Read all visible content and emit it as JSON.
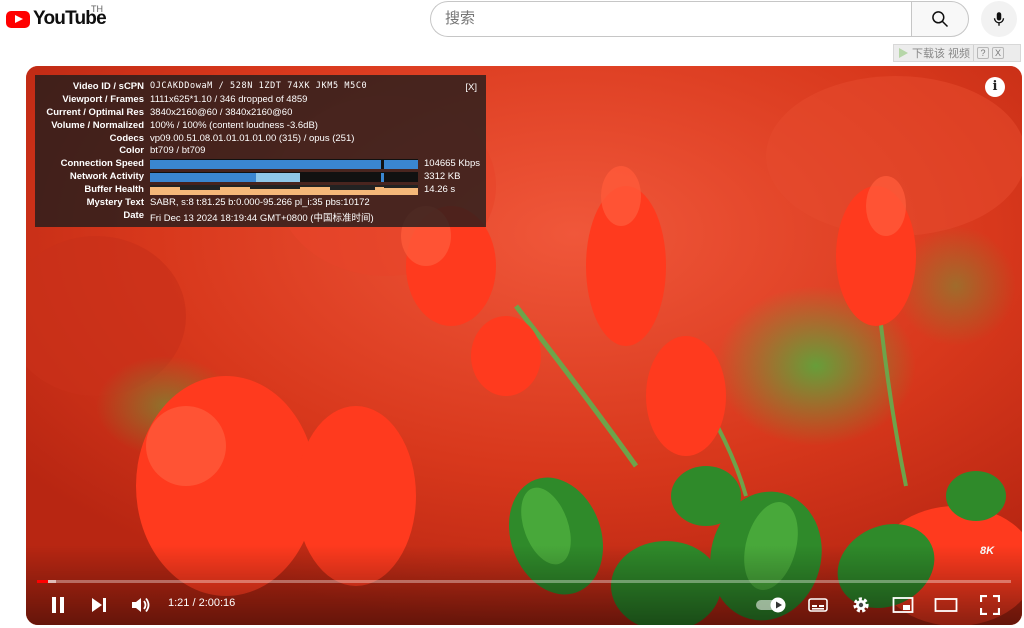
{
  "header": {
    "logo_text": "YouTube",
    "region": "TH",
    "search_placeholder": "搜索"
  },
  "download_bar": {
    "label": "下载该 视频",
    "help": "?",
    "close": "X"
  },
  "stats": {
    "close_label": "[X]",
    "rows": [
      {
        "label": "Video ID / sCPN",
        "value": "OJCAKDDowaM / 528N 1ZDT 74XK JKM5 M5C0"
      },
      {
        "label": "Viewport / Frames",
        "value": "1111x625*1.10 / 346 dropped of 4859"
      },
      {
        "label": "Current / Optimal Res",
        "value": "3840x2160@60 / 3840x2160@60"
      },
      {
        "label": "Volume / Normalized",
        "value": "100% / 100% (content loudness -3.6dB)"
      },
      {
        "label": "Codecs",
        "value": "vp09.00.51.08.01.01.01.01.00 (315) / opus (251)"
      },
      {
        "label": "Color",
        "value": "bt709 / bt709"
      },
      {
        "label": "Connection Speed",
        "value": "104665 Kbps"
      },
      {
        "label": "Network Activity",
        "value": "3312 KB"
      },
      {
        "label": "Buffer Health",
        "value": "14.26 s"
      },
      {
        "label": "Mystery Text",
        "value": "SABR, s:8 t:81.25 b:0.000-95.266 pl_i:35 pbs:10172"
      },
      {
        "label": "Date",
        "value": "Fri Dec 13 2024 18:19:44 GMT+0800 (中国标准时间)"
      }
    ]
  },
  "player": {
    "info_icon": "i",
    "badge_8k": "8K",
    "current_time": "1:21",
    "duration": "2:00:16",
    "time_display": "1:21 / 2:00:16",
    "progress": 0.011,
    "buffered": 0.02,
    "autoplay_on": true,
    "colors": {
      "accent": "#ff0000",
      "stats_bg": "#1c1c1c",
      "conn_bar": "#3a86d0",
      "buffer_bar": "#f5b879"
    }
  }
}
